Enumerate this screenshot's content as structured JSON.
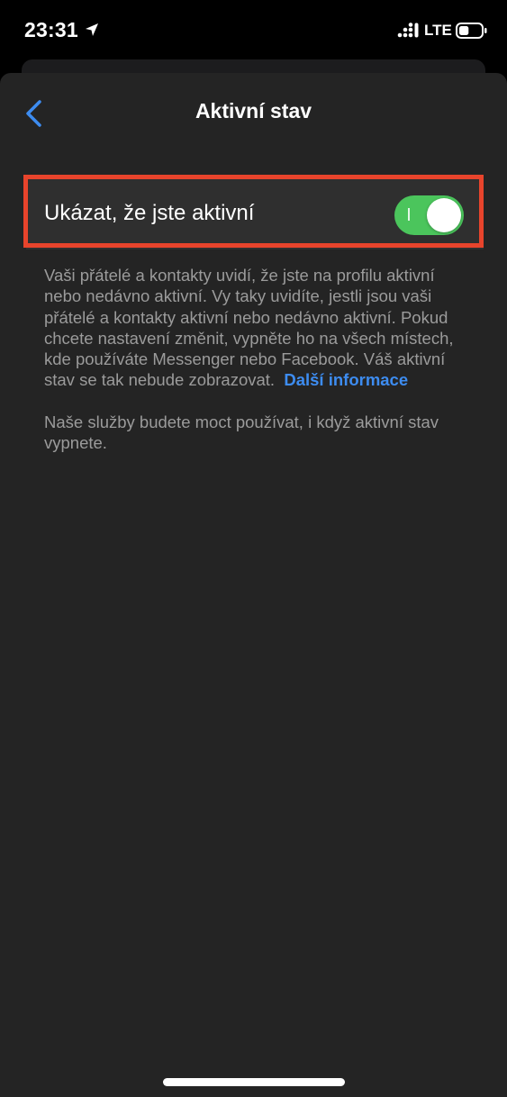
{
  "status_bar": {
    "time": "23:31",
    "network": "LTE",
    "battery_level": 0.45
  },
  "nav": {
    "title": "Aktivní stav"
  },
  "setting": {
    "label": "Ukázat, že jste aktivní",
    "enabled": true,
    "accent_color": "#4bc55c",
    "highlight_color": "#e8442c"
  },
  "description": {
    "text": "Vaši přátelé a kontakty uvidí, že jste na profilu aktivní nebo nedávno aktivní. Vy taky uvidíte, jestli jsou vaši přátelé a kontakty aktivní nebo nedávno aktivní. Pokud chcete nastavení změnit, vypněte ho na všech místech, kde používáte Messenger nebo Facebook. Váš aktivní stav se tak nebude zobrazovat.",
    "link": "Další informace",
    "link_color": "#3d8cf0",
    "note": "Naše služby budete moct používat, i když aktivní stav vypnete."
  }
}
